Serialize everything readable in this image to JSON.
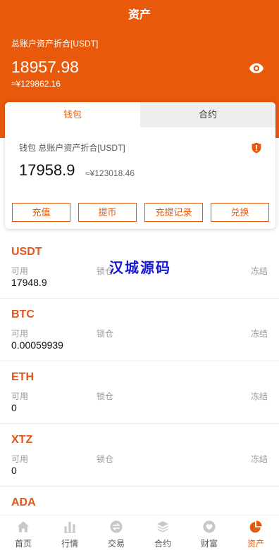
{
  "colors": {
    "primary": "#E8590C",
    "coin_symbol": "#E0561B",
    "tab_inactive_bg": "#EEEEEE",
    "nav_inactive_icon": "#C8C8C8",
    "watermark": "#1717D6"
  },
  "header": {
    "title": "资产",
    "total_label": "总账户资产折合[USDT]",
    "total_value": "18957.98",
    "total_cny": "≈¥129862.16",
    "visibility_icon": "eye-icon"
  },
  "tabs": [
    {
      "label": "钱包",
      "active": true
    },
    {
      "label": "合约",
      "active": false
    }
  ],
  "wallet": {
    "label": "钱包 总账户资产折合[USDT]",
    "value": "17958.9",
    "cny": "≈¥123018.46",
    "security_icon": "shield-icon"
  },
  "actions": [
    {
      "label": "充值"
    },
    {
      "label": "提币"
    },
    {
      "label": "充提记录"
    },
    {
      "label": "兑换"
    }
  ],
  "asset_columns": {
    "available": "可用",
    "locked": "锁仓",
    "frozen": "冻结"
  },
  "assets": [
    {
      "symbol": "USDT",
      "available": "17948.9"
    },
    {
      "symbol": "BTC",
      "available": "0.00059939"
    },
    {
      "symbol": "ETH",
      "available": "0"
    },
    {
      "symbol": "XTZ",
      "available": "0"
    },
    {
      "symbol": "ADA"
    }
  ],
  "watermark": "汉城源码",
  "nav": [
    {
      "label": "首页",
      "icon": "home-icon",
      "active": false
    },
    {
      "label": "行情",
      "icon": "bar-chart-icon",
      "active": false
    },
    {
      "label": "交易",
      "icon": "exchange-icon",
      "active": false
    },
    {
      "label": "合约",
      "icon": "layers-icon",
      "active": false
    },
    {
      "label": "财富",
      "icon": "heart-circle-icon",
      "active": false
    },
    {
      "label": "资产",
      "icon": "pie-chart-icon",
      "active": true
    }
  ]
}
